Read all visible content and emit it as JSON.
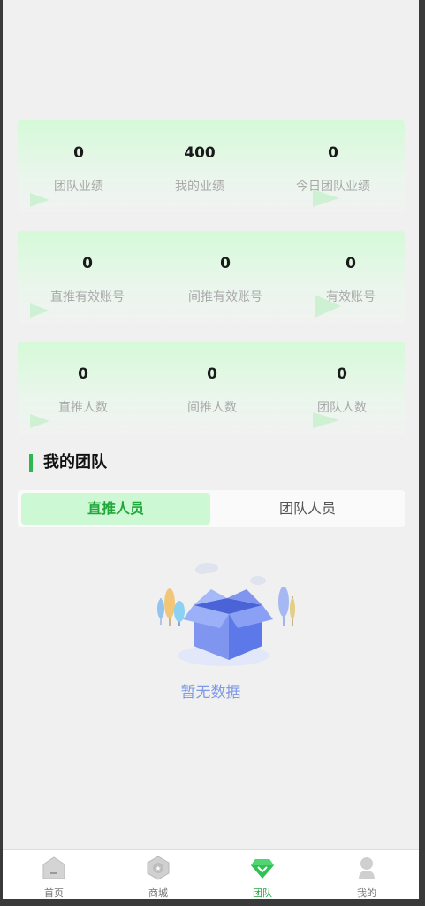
{
  "stats_rows": [
    [
      {
        "value": "0",
        "label": "团队业绩"
      },
      {
        "value": "400",
        "label": "我的业绩"
      },
      {
        "value": "0",
        "label": "今日团队业绩"
      }
    ],
    [
      {
        "value": "0",
        "label": "直推有效账号"
      },
      {
        "value": "0",
        "label": "间推有效账号"
      },
      {
        "value": "0",
        "label": "有效账号"
      }
    ],
    [
      {
        "value": "0",
        "label": "直推人数"
      },
      {
        "value": "0",
        "label": "间推人数"
      },
      {
        "value": "0",
        "label": "团队人数"
      }
    ]
  ],
  "team": {
    "title": "我的团队",
    "tabs": [
      {
        "label": "直推人员",
        "active": true
      },
      {
        "label": "团队人员",
        "active": false
      }
    ],
    "empty_text": "暂无数据"
  },
  "nav": [
    {
      "label": "首页",
      "icon": "home-icon",
      "active": false
    },
    {
      "label": "商城",
      "icon": "shop-icon",
      "active": false
    },
    {
      "label": "团队",
      "icon": "team-icon",
      "active": true
    },
    {
      "label": "我的",
      "icon": "profile-icon",
      "active": false
    }
  ],
  "colors": {
    "accent": "#2db84e",
    "active_tab_bg": "#cdf8d4",
    "empty_text": "#7f9ae6"
  }
}
